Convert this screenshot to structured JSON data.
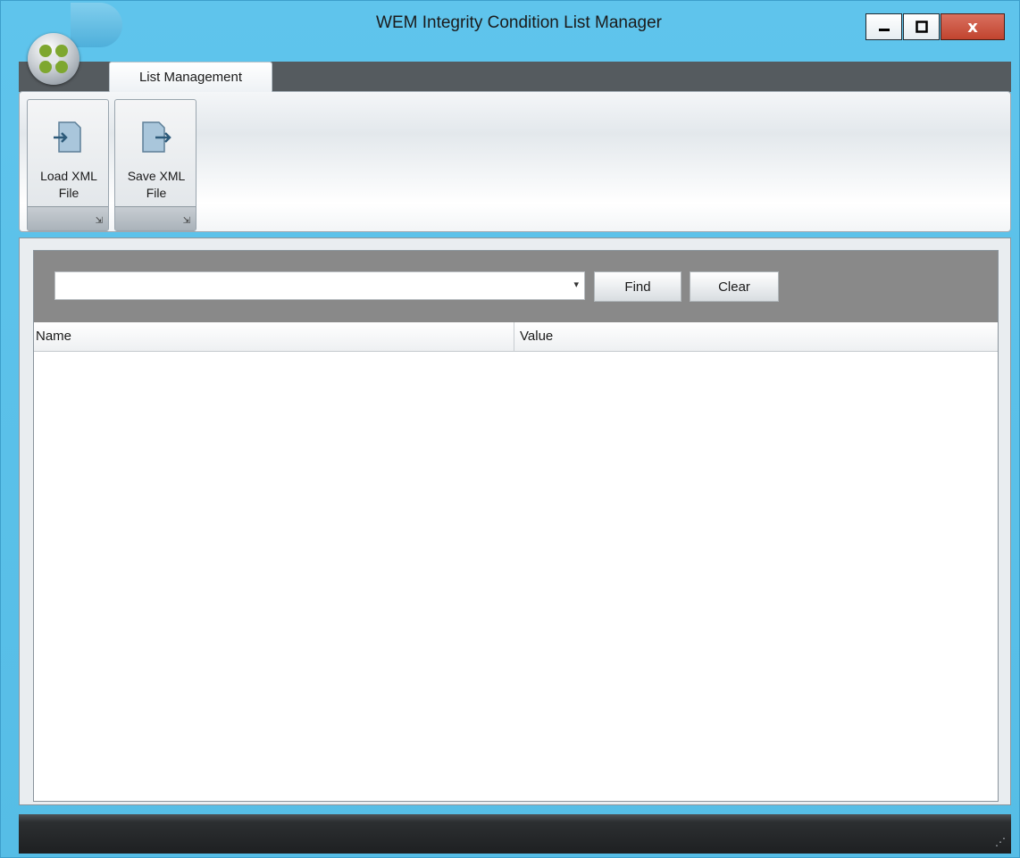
{
  "window": {
    "title": "WEM Integrity Condition List Manager",
    "controls": {
      "minimize": "minimize-icon",
      "maximize": "maximize-icon",
      "close_label": "x"
    }
  },
  "ribbon": {
    "tabs": [
      {
        "label": "List Management",
        "active": true
      }
    ],
    "groups": [
      {
        "label_line1": "Load XML",
        "label_line2": "File",
        "icon": "load-file-icon",
        "launcher": "⇲"
      },
      {
        "label_line1": "Save XML",
        "label_line2": "File",
        "icon": "save-file-icon",
        "launcher": "⇲"
      }
    ]
  },
  "search": {
    "value": "",
    "placeholder": "",
    "dropdown_arrow": "▾",
    "find_label": "Find",
    "clear_label": "Clear"
  },
  "grid": {
    "columns": [
      "Name",
      "Value"
    ],
    "rows": []
  },
  "statusbar": {
    "grip": "⋰"
  },
  "colors": {
    "titlebar": "#5fc4ec",
    "close_button": "#c1442f",
    "search_panel": "#898989",
    "status_bar": "#1e2022"
  }
}
